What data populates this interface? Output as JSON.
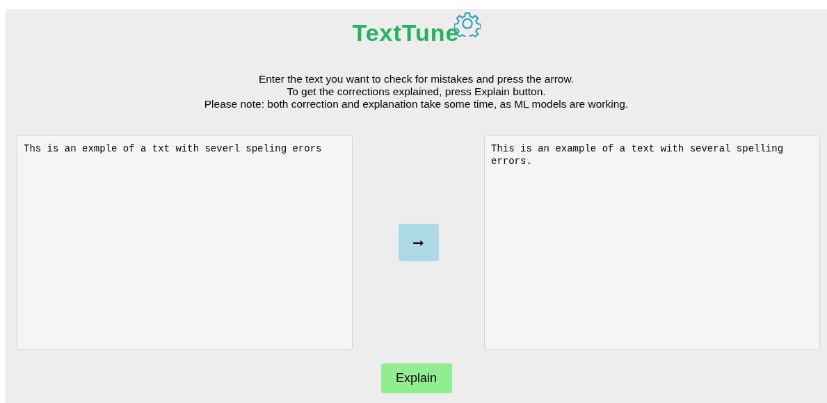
{
  "logo": {
    "text": "TextTune"
  },
  "instructions": [
    "Enter the text you want to check for mistakes and press the arrow.",
    "To get the corrections explained, press Explain button.",
    "Please note: both correction and explanation take some time, as ML models are working."
  ],
  "input": {
    "value": "Ths is an exmple of a txt with severl speling erors"
  },
  "correct_button": {
    "label": "➞"
  },
  "output": {
    "value": "This is an example of a text with several spelling errors."
  },
  "explain_button": {
    "label": "Explain"
  }
}
